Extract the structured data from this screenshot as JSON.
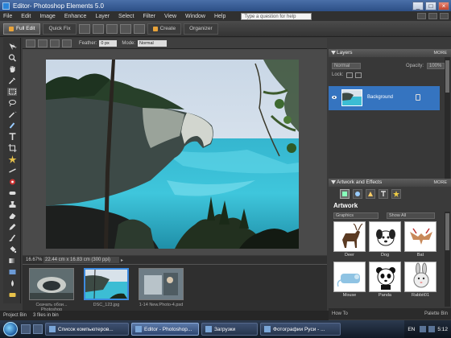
{
  "window": {
    "title": "Editor- Photoshop Elements 5.0",
    "controls": [
      "_",
      "□",
      "×"
    ]
  },
  "menu": {
    "items": [
      "File",
      "Edit",
      "Image",
      "Enhance",
      "Layer",
      "Select",
      "Filter",
      "View",
      "Window",
      "Help"
    ],
    "help_placeholder": "Type a question for help"
  },
  "modes": {
    "full": "Full Edit",
    "quick": "Quick Fix",
    "create": "Create",
    "organizer": "Organizer"
  },
  "options": {
    "feather_label": "Feather:",
    "feather_value": "0 px",
    "mode_label": "Mode:",
    "mode_value": "Normal"
  },
  "status": {
    "zoom": "16.67%",
    "doc_info": "22.44 cm x 16.83 cm (300 ppi)"
  },
  "project_bin": {
    "thumbs": [
      {
        "caption": "Скачать обои... Photoshop"
      },
      {
        "caption": "DSC_123.jpg"
      },
      {
        "caption": "1-14 New.Photo-4.psd"
      }
    ],
    "footer_label": "Project Bin",
    "footer_value": "3 files in bin"
  },
  "layers_panel": {
    "title": "Layers",
    "more": "MORE",
    "blend": "Normal",
    "opacity": "100%",
    "lock_label": "Lock:",
    "layer_name": "Background"
  },
  "artwork_panel": {
    "title": "Artwork and Effects",
    "more": "MORE",
    "heading": "Artwork",
    "dropdown1": "Graphics",
    "dropdown2": "Show All",
    "items": [
      {
        "label": "Deer"
      },
      {
        "label": "Dog"
      },
      {
        "label": "Bat"
      },
      {
        "label": "Mouse"
      },
      {
        "label": "Panda"
      },
      {
        "label": "Rabbit01"
      }
    ],
    "footer_left": "How To",
    "footer_right": "Palette Bin"
  },
  "taskbar": {
    "buttons": [
      {
        "label": "Список компьютеров..."
      },
      {
        "label": "Editor - Photoshop..."
      },
      {
        "label": "Загрузки"
      },
      {
        "label": "Фотографии Руси - ..."
      }
    ],
    "lang": "EN",
    "clock": "5:12"
  },
  "colors": {
    "accent": "#3574c0",
    "titlebar": "#2c4f86"
  }
}
